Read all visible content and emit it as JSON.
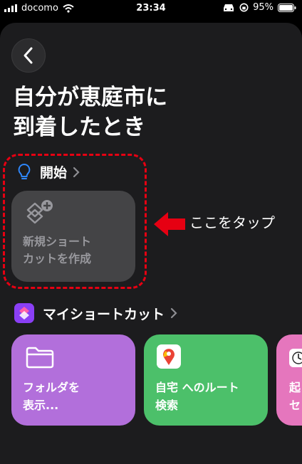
{
  "status": {
    "carrier": "docomo",
    "time": "23:34",
    "battery": "95%"
  },
  "title": [
    "自分が恵庭市に",
    "到着したとき"
  ],
  "start_section": {
    "label": "開始"
  },
  "new_shortcut": {
    "line1": "新規ショート",
    "line2": "カットを作成"
  },
  "callout": "ここをタップ",
  "my_shortcuts": {
    "label": "マイショートカット",
    "cards": [
      {
        "line1": "フォルダを",
        "line2": "表示...",
        "color": "#b26fdb"
      },
      {
        "line1": "自宅 へのルート",
        "line2": "検索",
        "color": "#4cc06a"
      },
      {
        "line1": "起",
        "line2": "セ",
        "color": "#e576bd"
      }
    ]
  },
  "colors": {
    "accent_red": "#e60012",
    "bulb_blue": "#2f88ff"
  }
}
